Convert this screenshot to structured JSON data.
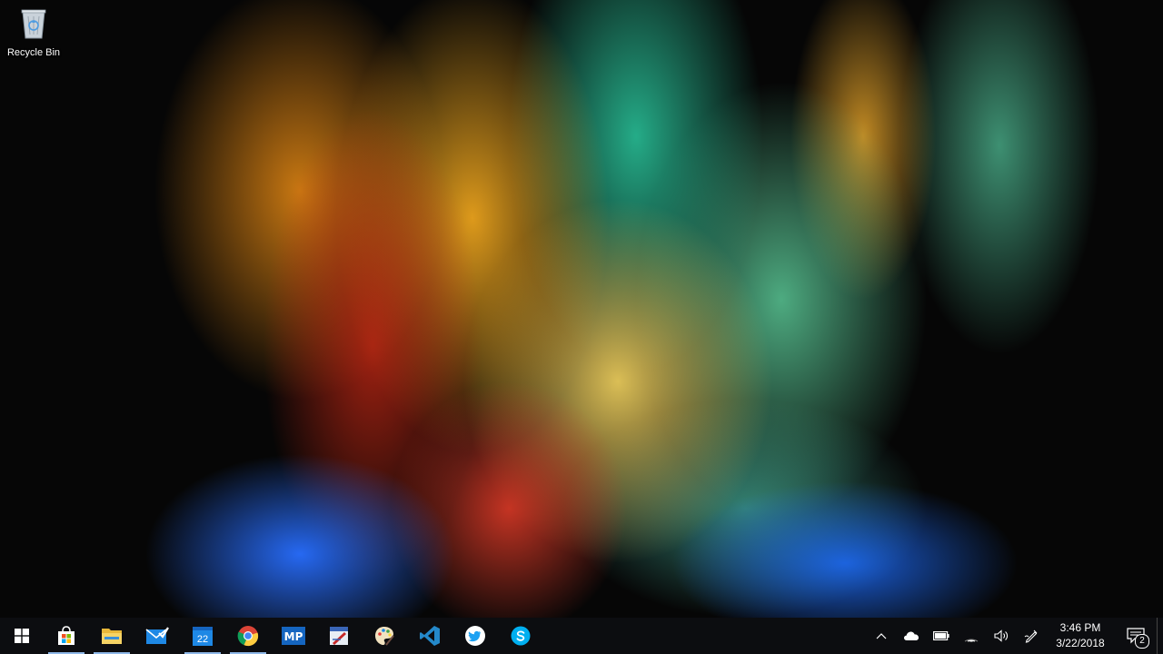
{
  "desktop": {
    "wallpaper": "colorful-powder-explosion",
    "icons": [
      {
        "label": "Recycle Bin",
        "icon": "recycle-bin-icon"
      }
    ]
  },
  "taskbar": {
    "start": {
      "icon": "windows-logo-icon"
    },
    "pinned": [
      {
        "name": "Microsoft Store",
        "icon": "store-icon",
        "running": true
      },
      {
        "name": "File Explorer",
        "icon": "file-explorer-icon",
        "running": true
      },
      {
        "name": "Mail",
        "icon": "mail-icon",
        "running": false
      },
      {
        "name": "Calendar",
        "icon": "calendar-icon",
        "text": "22",
        "running": true
      },
      {
        "name": "Google Chrome",
        "icon": "chrome-icon",
        "running": true
      },
      {
        "name": "MP",
        "icon": "mp-app-icon",
        "text": "MP",
        "running": false
      },
      {
        "name": "Drawing app",
        "icon": "sketch-app-icon",
        "running": false
      },
      {
        "name": "Paint",
        "icon": "paint-palette-icon",
        "running": false
      },
      {
        "name": "Visual Studio Code",
        "icon": "vscode-icon",
        "running": false
      },
      {
        "name": "Twitter",
        "icon": "twitter-icon",
        "running": false
      },
      {
        "name": "Skype",
        "icon": "skype-icon",
        "running": false
      }
    ],
    "tray": {
      "icons": [
        "chevron-up-icon",
        "onedrive-cloud-icon",
        "battery-icon",
        "wifi-icon",
        "volume-icon",
        "pen-icon"
      ],
      "time": "3:46 PM",
      "date": "3/22/2018",
      "notifications_count": "2"
    }
  },
  "colors": {
    "taskbar_bg": "#0c0d10",
    "running_indicator": "#8fb8e8",
    "accent_blue": "#1e88e5"
  }
}
